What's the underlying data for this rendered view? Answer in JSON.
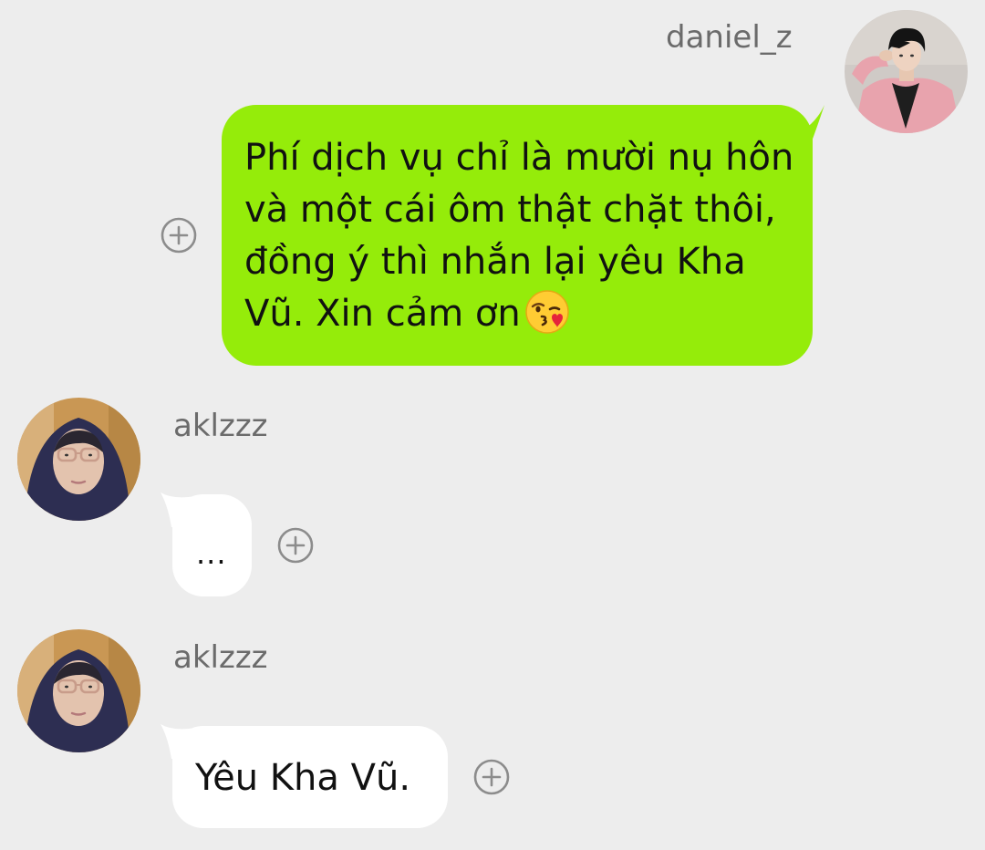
{
  "sent": {
    "sender_name": "daniel_z",
    "text": "Phí dịch vụ chỉ là mười nụ hôn và một cái ôm thật chặt thôi, đồng ý thì nhắn lại yêu Kha Vũ. Xin cảm ơn",
    "emoji": "face-blowing-a-kiss",
    "bubble_color": "#95ec0a"
  },
  "reply_1": {
    "sender_name": "aklzzz",
    "text": "...",
    "bubble_color": "#ffffff"
  },
  "reply_2": {
    "sender_name": "aklzzz",
    "text": "Yêu Kha Vũ.",
    "bubble_color": "#ffffff"
  },
  "colors": {
    "background": "#ededed",
    "name_text": "#6b6b6b",
    "add_icon": "#8c8c8c"
  }
}
